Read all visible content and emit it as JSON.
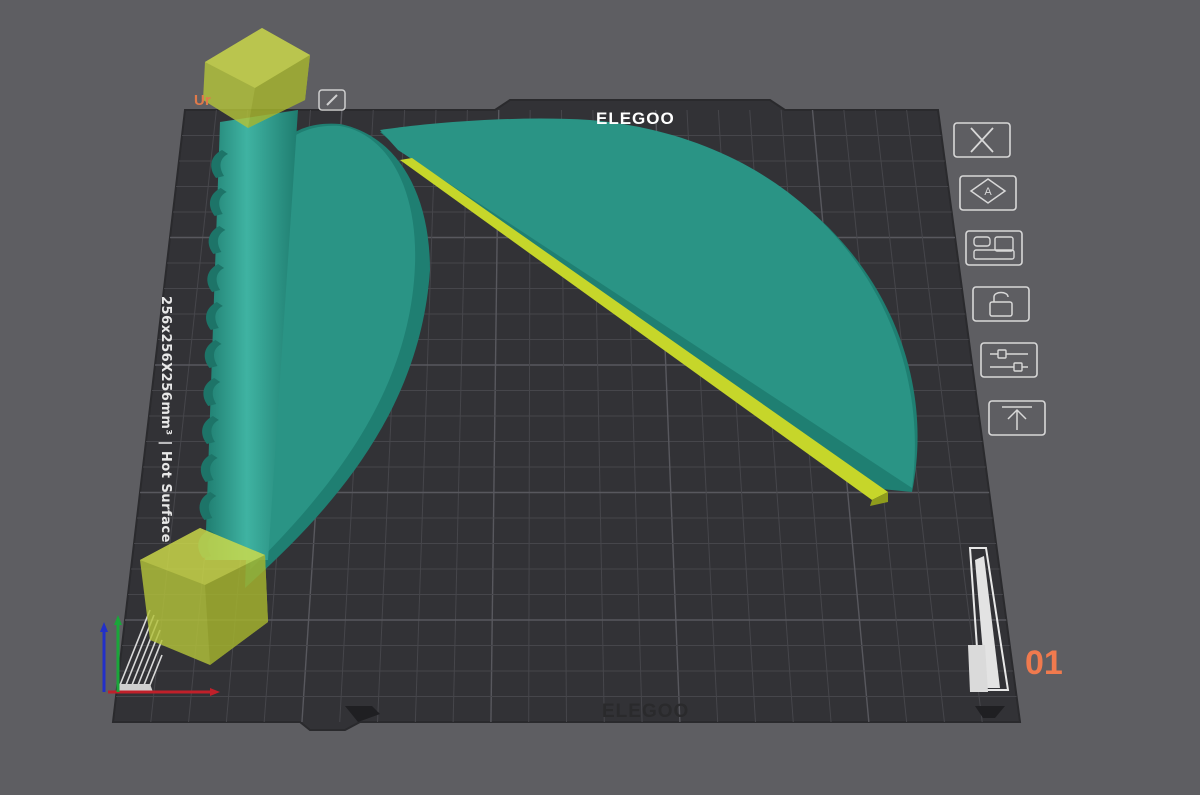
{
  "viewport": {
    "plate_name": "Ur",
    "brand_top": "ELEGOO",
    "brand_bottom": "ELEGOO",
    "bed_label": "256x256X256mm³ | Hot Surface",
    "plate_number": "01"
  },
  "plate_toolbar": [
    {
      "name": "remove-plate",
      "icon": "close-icon"
    },
    {
      "name": "auto-orient-plate",
      "icon": "auto-orient-icon"
    },
    {
      "name": "arrange-plate",
      "icon": "arrange-icon"
    },
    {
      "name": "lock-plate",
      "icon": "lock-icon"
    },
    {
      "name": "plate-settings",
      "icon": "sliders-icon"
    },
    {
      "name": "move-plate-to-top",
      "icon": "move-to-top-icon"
    }
  ],
  "colors": {
    "background": "#5e5e62",
    "bed": "#323236",
    "grid": "#4a4a4f",
    "model_teal": "#2a9485",
    "model_selected": "#c6d62a",
    "accent_orange": "#f07a4e"
  }
}
